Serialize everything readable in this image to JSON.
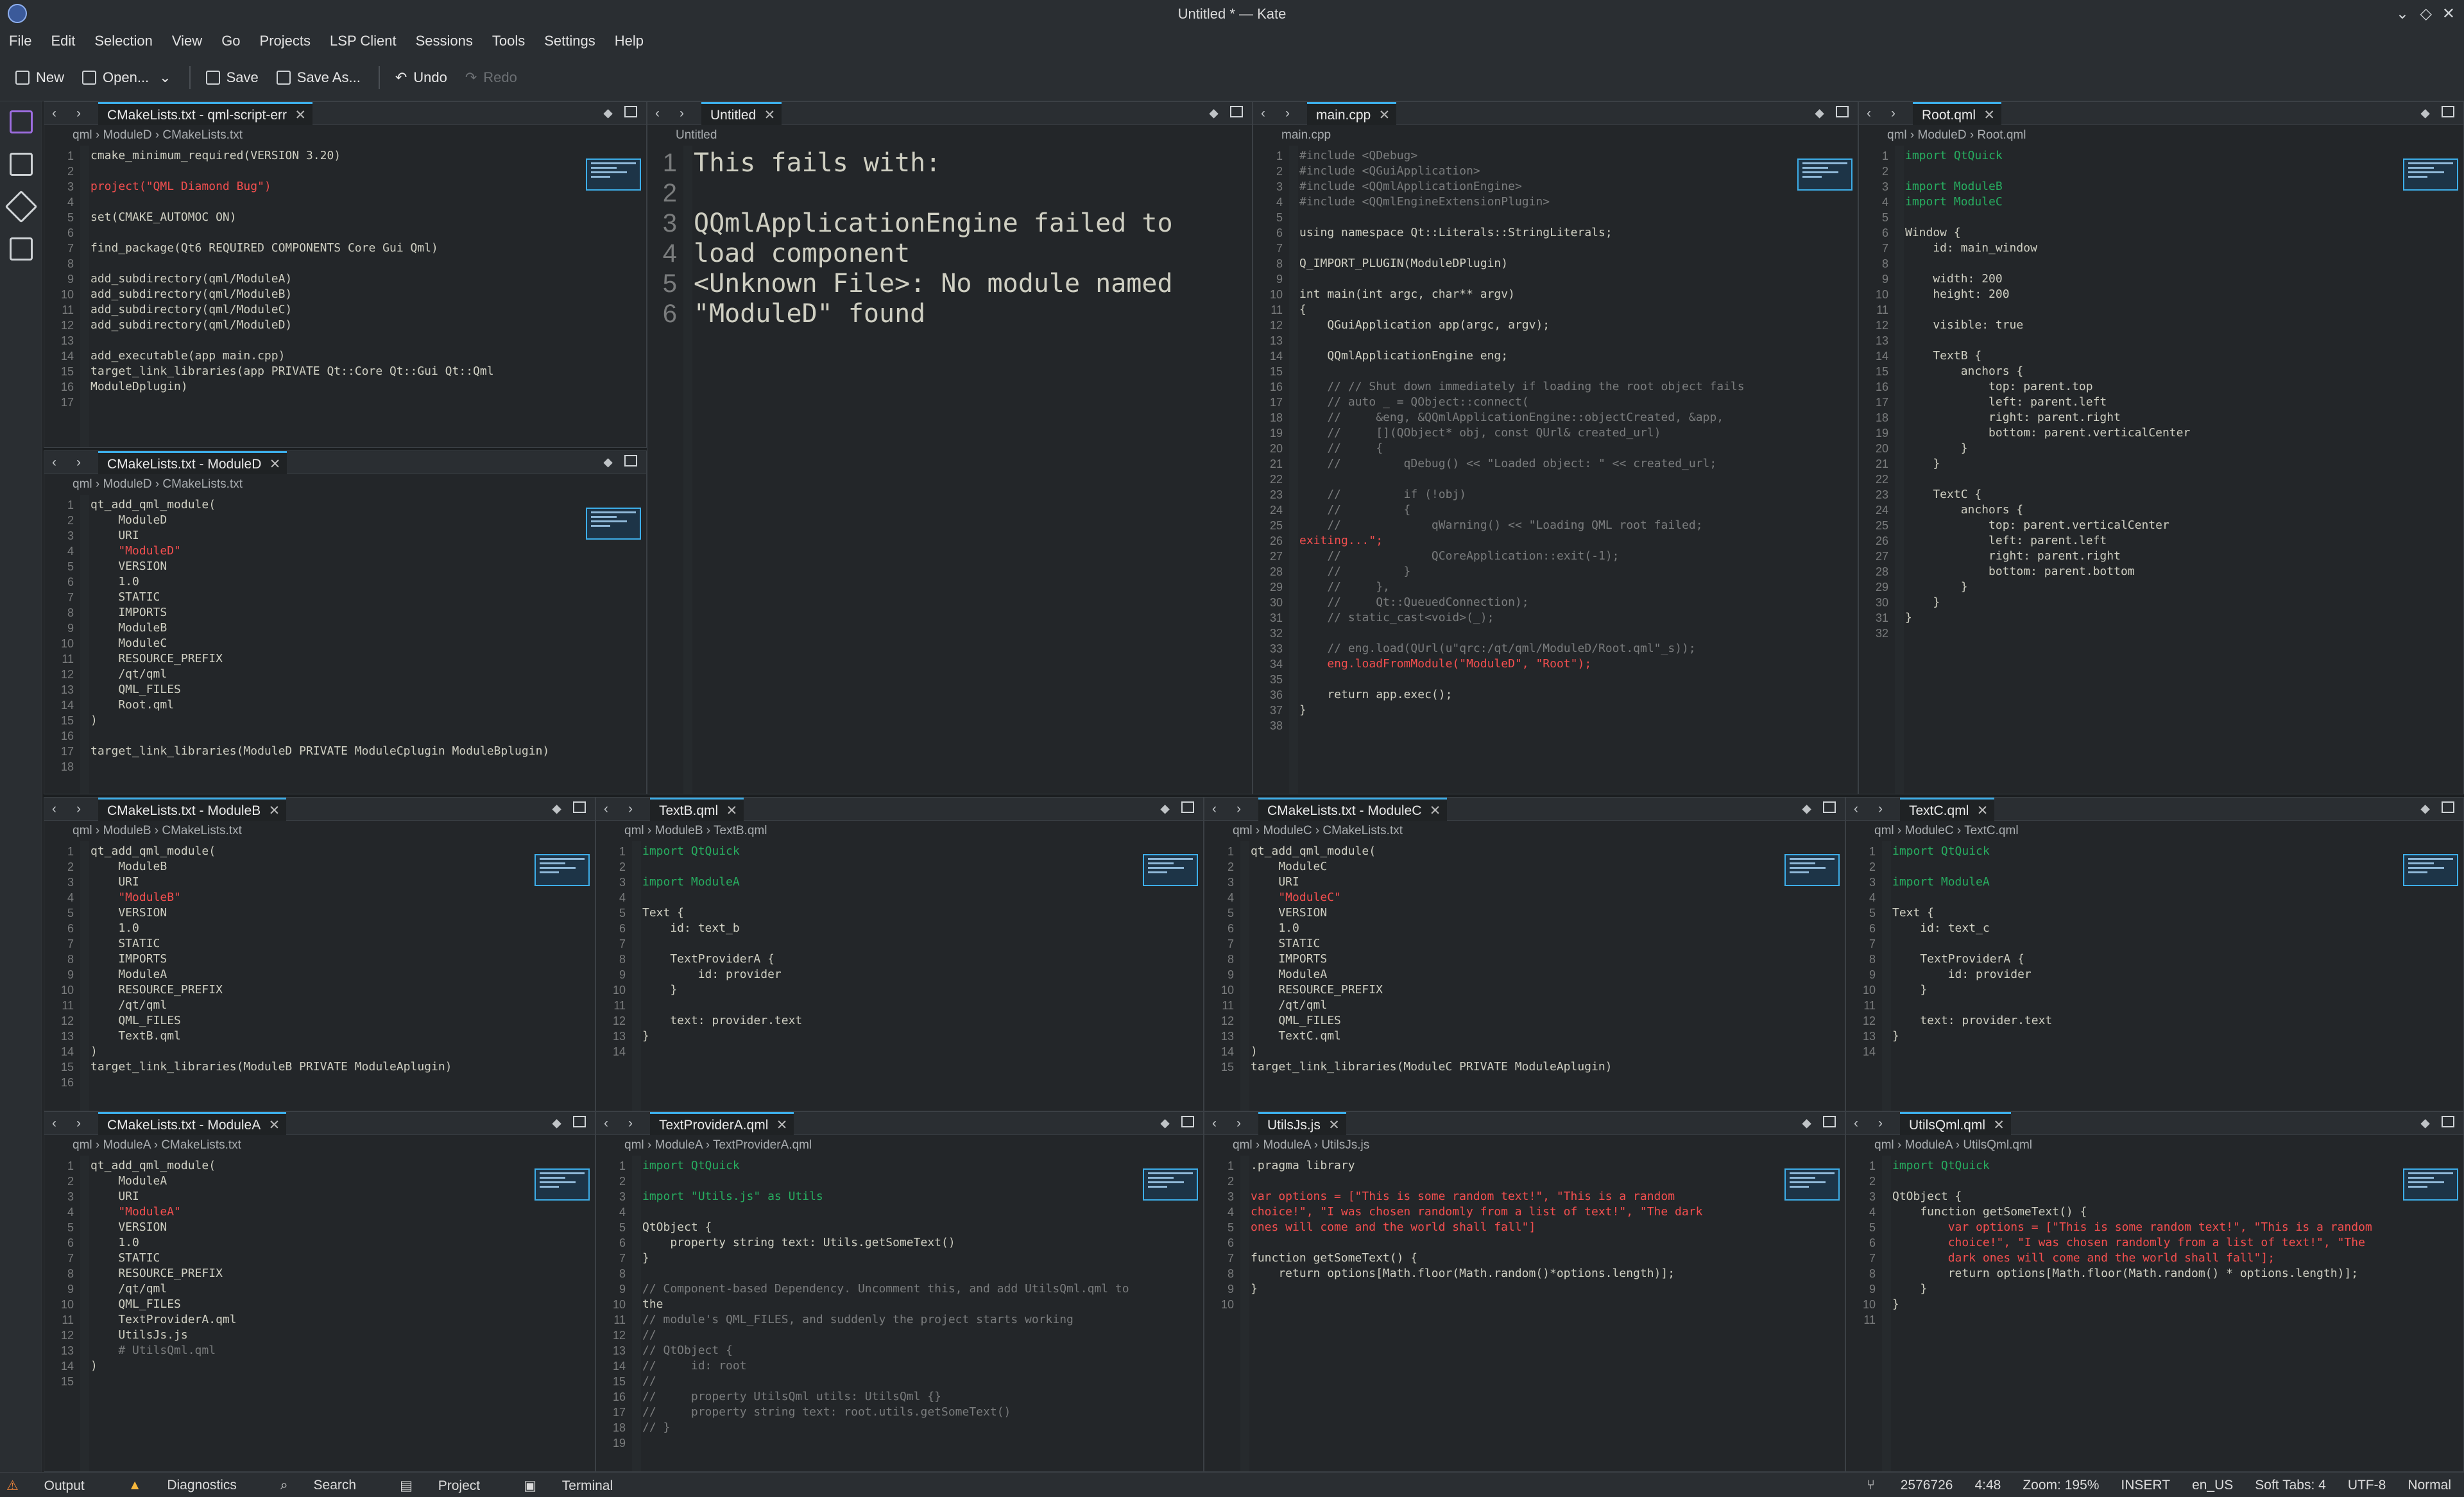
{
  "window": {
    "title": "Untitled * — Kate"
  },
  "menu": [
    "File",
    "Edit",
    "Selection",
    "View",
    "Go",
    "Projects",
    "LSP Client",
    "Sessions",
    "Tools",
    "Settings",
    "Help"
  ],
  "toolbar": {
    "new": "New",
    "open": "Open...",
    "save": "Save",
    "save_as": "Save As...",
    "undo": "Undo",
    "redo": "Redo"
  },
  "status": {
    "output": "Output",
    "diagnostics": "Diagnostics",
    "search": "Search",
    "project": "Project",
    "terminal": "Terminal",
    "branch": "2576726",
    "position": "4:48",
    "zoom": "Zoom: 195%",
    "mode": "INSERT",
    "locale": "en_US",
    "tabs": "Soft Tabs: 4",
    "encoding": "UTF-8",
    "eol": "Normal"
  },
  "panes": [
    {
      "id": "p1",
      "tab": "CMakeLists.txt - qml-script-err",
      "crumb": "qml  ›  ModuleD  ›  CMakeLists.txt",
      "lines": [
        "cmake_minimum_required(VERSION 3.20)",
        "",
        "project(\"QML Diamond Bug\")",
        "",
        "set(CMAKE_AUTOMOC ON)",
        "",
        "find_package(Qt6 REQUIRED COMPONENTS Core Gui Qml)",
        "",
        "add_subdirectory(qml/ModuleA)",
        "add_subdirectory(qml/ModuleB)",
        "add_subdirectory(qml/ModuleC)",
        "add_subdirectory(qml/ModuleD)",
        "",
        "add_executable(app main.cpp)",
        "target_link_libraries(app PRIVATE Qt::Core Qt::Gui Qt::Qml",
        "ModuleDplugin)",
        ""
      ]
    },
    {
      "id": "p2",
      "tab": "Untitled",
      "crumb": "Untitled",
      "lines": [
        "This fails with:",
        "",
        "QQmlApplicationEngine failed to",
        "load component",
        "<Unknown File>: No module named",
        "\"ModuleD\" found"
      ]
    },
    {
      "id": "p3",
      "tab": "main.cpp",
      "crumb": "main.cpp",
      "lines": [
        "#include <QDebug>",
        "#include <QGuiApplication>",
        "#include <QQmlApplicationEngine>",
        "#include <QQmlEngineExtensionPlugin>",
        "",
        "using namespace Qt::Literals::StringLiterals;",
        "",
        "Q_IMPORT_PLUGIN(ModuleDPlugin)",
        "",
        "int main(int argc, char** argv)",
        "{",
        "    QGuiApplication app(argc, argv);",
        "",
        "    QQmlApplicationEngine eng;",
        "",
        "    // // Shut down immediately if loading the root object fails",
        "    // auto _ = QObject::connect(",
        "    //     &eng, &QQmlApplicationEngine::objectCreated, &app,",
        "    //     [](QObject* obj, const QUrl& created_url)",
        "    //     {",
        "    //         qDebug() << \"Loaded object: \" << created_url;",
        "",
        "    //         if (!obj)",
        "    //         {",
        "    //             qWarning() << \"Loading QML root failed;",
        "exiting...\";",
        "    //             QCoreApplication::exit(-1);",
        "    //         }",
        "    //     },",
        "    //     Qt::QueuedConnection);",
        "    // static_cast<void>(_);",
        "",
        "    // eng.load(QUrl(u\"qrc:/qt/qml/ModuleD/Root.qml\"_s));",
        "    eng.loadFromModule(\"ModuleD\", \"Root\");",
        "",
        "    return app.exec();",
        "}",
        ""
      ]
    },
    {
      "id": "p4",
      "tab": "Root.qml",
      "crumb": "qml  ›  ModuleD  ›  Root.qml",
      "lines": [
        "import QtQuick",
        "",
        "import ModuleB",
        "import ModuleC",
        "",
        "Window {",
        "    id: main_window",
        "",
        "    width: 200",
        "    height: 200",
        "",
        "    visible: true",
        "",
        "    TextB {",
        "        anchors {",
        "            top: parent.top",
        "            left: parent.left",
        "            right: parent.right",
        "            bottom: parent.verticalCenter",
        "        }",
        "    }",
        "",
        "    TextC {",
        "        anchors {",
        "            top: parent.verticalCenter",
        "            left: parent.left",
        "            right: parent.right",
        "            bottom: parent.bottom",
        "        }",
        "    }",
        "}",
        ""
      ]
    },
    {
      "id": "p5",
      "tab": "CMakeLists.txt - ModuleD",
      "crumb": "qml  ›  ModuleD  ›  CMakeLists.txt",
      "lines": [
        "qt_add_qml_module(",
        "    ModuleD",
        "    URI",
        "    \"ModuleD\"",
        "    VERSION",
        "    1.0",
        "    STATIC",
        "    IMPORTS",
        "    ModuleB",
        "    ModuleC",
        "    RESOURCE_PREFIX",
        "    /qt/qml",
        "    QML_FILES",
        "    Root.qml",
        ")",
        "",
        "target_link_libraries(ModuleD PRIVATE ModuleCplugin ModuleBplugin)",
        ""
      ]
    },
    {
      "id": "p6",
      "tab": "CMakeLists.txt - ModuleB",
      "crumb": "qml  ›  ModuleB  ›  CMakeLists.txt",
      "lines": [
        "qt_add_qml_module(",
        "    ModuleB",
        "    URI",
        "    \"ModuleB\"",
        "    VERSION",
        "    1.0",
        "    STATIC",
        "    IMPORTS",
        "    ModuleA",
        "    RESOURCE_PREFIX",
        "    /qt/qml",
        "    QML_FILES",
        "    TextB.qml",
        ")",
        "target_link_libraries(ModuleB PRIVATE ModuleAplugin)",
        ""
      ]
    },
    {
      "id": "p7",
      "tab": "TextB.qml",
      "crumb": "qml  ›  ModuleB  ›  TextB.qml",
      "lines": [
        "import QtQuick",
        "",
        "import ModuleA",
        "",
        "Text {",
        "    id: text_b",
        "",
        "    TextProviderA {",
        "        id: provider",
        "    }",
        "",
        "    text: provider.text",
        "}",
        ""
      ]
    },
    {
      "id": "p8",
      "tab": "CMakeLists.txt - ModuleC",
      "crumb": "qml  ›  ModuleC  ›  CMakeLists.txt",
      "lines": [
        "qt_add_qml_module(",
        "    ModuleC",
        "    URI",
        "    \"ModuleC\"",
        "    VERSION",
        "    1.0",
        "    STATIC",
        "    IMPORTS",
        "    ModuleA",
        "    RESOURCE_PREFIX",
        "    /qt/qml",
        "    QML_FILES",
        "    TextC.qml",
        ")",
        "target_link_libraries(ModuleC PRIVATE ModuleAplugin)"
      ]
    },
    {
      "id": "p9",
      "tab": "TextC.qml",
      "crumb": "qml  ›  ModuleC  ›  TextC.qml",
      "lines": [
        "import QtQuick",
        "",
        "import ModuleA",
        "",
        "Text {",
        "    id: text_c",
        "",
        "    TextProviderA {",
        "        id: provider",
        "    }",
        "",
        "    text: provider.text",
        "}",
        ""
      ]
    },
    {
      "id": "p10",
      "tab": "CMakeLists.txt - ModuleA",
      "crumb": "qml  ›  ModuleA  ›  CMakeLists.txt",
      "lines": [
        "qt_add_qml_module(",
        "    ModuleA",
        "    URI",
        "    \"ModuleA\"",
        "    VERSION",
        "    1.0",
        "    STATIC",
        "    RESOURCE_PREFIX",
        "    /qt/qml",
        "    QML_FILES",
        "    TextProviderA.qml",
        "    UtilsJs.js",
        "    # UtilsQml.qml",
        ")",
        ""
      ]
    },
    {
      "id": "p11",
      "tab": "TextProviderA.qml",
      "crumb": "qml  ›  ModuleA  ›  TextProviderA.qml",
      "lines": [
        "import QtQuick",
        "",
        "import \"Utils.js\" as Utils",
        "",
        "QtObject {",
        "    property string text: Utils.getSomeText()",
        "}",
        "",
        "// Component-based Dependency. Uncomment this, and add UtilsQml.qml to",
        "the",
        "// module's QML_FILES, and suddenly the project starts working",
        "//",
        "// QtObject {",
        "//     id: root",
        "//",
        "//     property UtilsQml utils: UtilsQml {}",
        "//     property string text: root.utils.getSomeText()",
        "// }",
        ""
      ]
    },
    {
      "id": "p12",
      "tab": "UtilsJs.js",
      "crumb": "qml  ›  ModuleA  ›  UtilsJs.js",
      "lines": [
        ".pragma library",
        "",
        "var options = [\"This is some random text!\", \"This is a random",
        "choice!\", \"I was chosen randomly from a list of text!\", \"The dark",
        "ones will come and the world shall fall\"]",
        "",
        "function getSomeText() {",
        "    return options[Math.floor(Math.random()*options.length)];",
        "}",
        ""
      ]
    },
    {
      "id": "p13",
      "tab": "UtilsQml.qml",
      "crumb": "qml  ›  ModuleA  ›  UtilsQml.qml",
      "lines": [
        "import QtQuick",
        "",
        "QtObject {",
        "    function getSomeText() {",
        "        var options = [\"This is some random text!\", \"This is a random",
        "        choice!\", \"I was chosen randomly from a list of text!\", \"The",
        "        dark ones will come and the world shall fall\"];",
        "        return options[Math.floor(Math.random() * options.length)];",
        "    }",
        "}",
        ""
      ]
    }
  ]
}
